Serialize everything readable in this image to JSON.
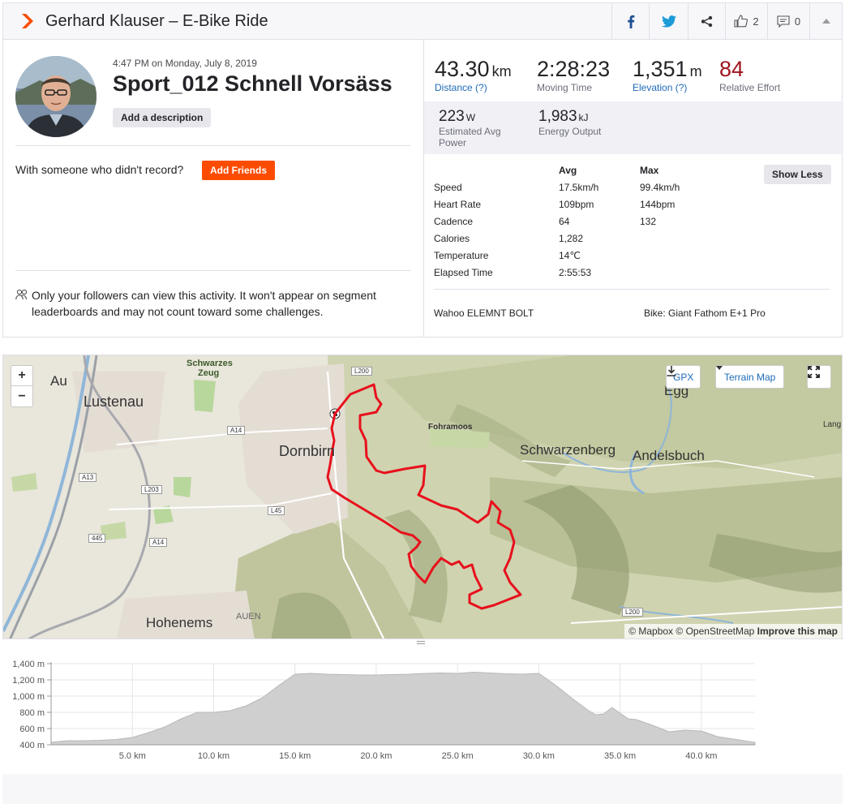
{
  "header": {
    "title": "Gerhard Klauser – E-Bike Ride",
    "kudos_count": "2",
    "comment_count": "0",
    "icons": [
      "strava-chevron-icon",
      "facebook-icon",
      "twitter-icon",
      "share-icon",
      "thumbs-up-icon",
      "comment-icon",
      "collapse-caret-icon"
    ]
  },
  "activity": {
    "datetime": "4:47 PM on Monday, July 8, 2019",
    "name": "Sport_012 Schnell Vorsäss",
    "add_description": "Add a description",
    "with_someone": "With someone who didn't record?",
    "add_friends": "Add Friends",
    "privacy": "Only your followers can view this activity. It won't appear on segment leaderboards and may not count toward some challenges."
  },
  "stats": {
    "distance": {
      "value": "43.30",
      "unit": "km",
      "label": "Distance (?)"
    },
    "moving_time": {
      "value": "2:28:23",
      "label": "Moving Time"
    },
    "elevation": {
      "value": "1,351",
      "unit": "m",
      "label": "Elevation (?)"
    },
    "relative_effort": {
      "value": "84",
      "label": "Relative Effort"
    },
    "power": {
      "value": "223",
      "unit": "W",
      "label_line1": "Estimated Avg",
      "label_line2": "Power"
    },
    "energy": {
      "value": "1,983",
      "unit": "kJ",
      "label": "Energy Output"
    }
  },
  "more_stats": {
    "col_avg": "Avg",
    "col_max": "Max",
    "show_less": "Show Less",
    "rows": [
      {
        "label": "Speed",
        "avg": "17.5km/h",
        "max": "99.4km/h"
      },
      {
        "label": "Heart Rate",
        "avg": "109bpm",
        "max": "144bpm"
      },
      {
        "label": "Cadence",
        "avg": "64",
        "max": "132"
      },
      {
        "label": "Calories",
        "avg": "1,282",
        "max": ""
      },
      {
        "label": "Temperature",
        "avg": "14℃",
        "max": ""
      },
      {
        "label": "Elapsed Time",
        "avg": "2:55:53",
        "max": ""
      }
    ],
    "device": "Wahoo ELEMNT BOLT",
    "bike": "Bike: Giant Fathom E+1 Pro"
  },
  "map": {
    "zoom_in": "+",
    "zoom_out": "−",
    "gpx": "GPX",
    "terrain": "Terrain Map",
    "attribution_1": "© Mapbox",
    "attribution_2": "© OpenStreetMap",
    "attribution_3": "Improve this map",
    "route_color": "#e8101c",
    "labels": {
      "au": "Au",
      "lustenau": "Lustenau",
      "schwarzes": "Schwarzes",
      "zeug": "Zeug",
      "dornbirn": "Dornbirn",
      "fohramoos": "Fohramoos",
      "schwarzenberg": "Schwarzenberg",
      "andelsbuch": "Andelsbuch",
      "egg": "Egg",
      "lang": "Lang",
      "hohenems": "Hohenems",
      "auen": "AUEN",
      "a14a": "A14",
      "a14b": "A14",
      "a13": "A13",
      "l203": "L203",
      "l45": "L45",
      "n445": "445",
      "l200a": "L200",
      "l200b": "L200"
    }
  },
  "chart_data": {
    "type": "area",
    "title": "",
    "xlabel": "",
    "ylabel": "",
    "x_unit": "km",
    "y_unit": "m",
    "xlim": [
      0,
      43.3
    ],
    "ylim": [
      400,
      1400
    ],
    "y_ticks": [
      "400 m",
      "600 m",
      "800 m",
      "1,000 m",
      "1,200 m",
      "1,400 m"
    ],
    "x_ticks": [
      "5.0 km",
      "10.0 km",
      "15.0 km",
      "20.0 km",
      "25.0 km",
      "30.0 km",
      "35.0 km",
      "40.0 km"
    ],
    "series": [
      {
        "color": "#cfcfcf",
        "x": [
          0,
          1,
          2,
          3,
          4,
          5,
          6,
          7,
          8,
          9,
          10,
          11,
          12,
          13,
          14,
          15,
          16,
          17,
          18,
          19,
          20,
          21,
          22,
          23,
          24,
          25,
          26,
          27,
          28,
          29,
          30,
          31,
          32,
          33,
          33.5,
          34,
          34.5,
          35,
          35.5,
          36,
          37,
          38,
          39,
          40,
          41,
          42,
          43.3
        ],
        "y": [
          430,
          450,
          450,
          455,
          465,
          490,
          550,
          620,
          720,
          800,
          800,
          820,
          880,
          980,
          1130,
          1270,
          1280,
          1270,
          1265,
          1260,
          1260,
          1265,
          1270,
          1280,
          1285,
          1280,
          1295,
          1285,
          1275,
          1270,
          1280,
          1140,
          980,
          830,
          770,
          780,
          860,
          790,
          720,
          710,
          640,
          560,
          580,
          570,
          500,
          470,
          430
        ]
      }
    ]
  }
}
